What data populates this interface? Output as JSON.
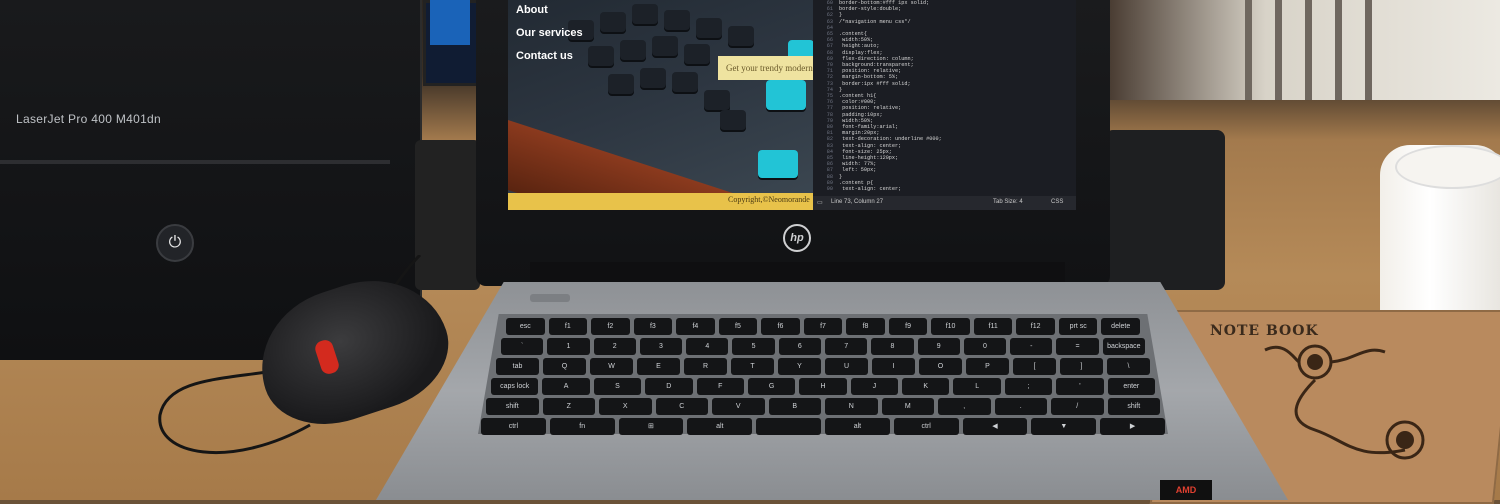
{
  "scene": {
    "printer": {
      "label": "LaserJet Pro 400 M401dn",
      "power_icon": "power-icon"
    },
    "laptop": {
      "brand_logo": "hp"
    },
    "notebook": {
      "title": "NOTE BOOK"
    },
    "sticker": {
      "text": "AMD"
    }
  },
  "website_preview": {
    "nav": [
      "About",
      "Our services",
      "Contact us"
    ],
    "promo_text": "Get your trendy modern w",
    "footer_text": "Copyright,©Neomorande"
  },
  "code_editor": {
    "lines": [
      {
        "n": "60",
        "text": "border-bottom:#fff 1px solid;"
      },
      {
        "n": "61",
        "text": "border-style:double;"
      },
      {
        "n": "62",
        "text": "}"
      },
      {
        "n": "63",
        "text": "/*navigation menu css*/"
      },
      {
        "n": "64",
        "text": ""
      },
      {
        "n": "65",
        "text": ".content{"
      },
      {
        "n": "66",
        "text": "    width:50%;"
      },
      {
        "n": "67",
        "text": "    height:auto;"
      },
      {
        "n": "68",
        "text": "    display:flex;"
      },
      {
        "n": "69",
        "text": "    flex-direction: column;"
      },
      {
        "n": "70",
        "text": "    background:transparent;"
      },
      {
        "n": "71",
        "text": "    position: relative;"
      },
      {
        "n": "72",
        "text": "    margin-bottom: 5%;"
      },
      {
        "n": "73",
        "text": "    border:1px #fff solid;"
      },
      {
        "n": "74",
        "text": "}"
      },
      {
        "n": "75",
        "text": ".content h1{"
      },
      {
        "n": "76",
        "text": "    color:#000;"
      },
      {
        "n": "77",
        "text": "    position: relative;"
      },
      {
        "n": "78",
        "text": "    padding:10px;"
      },
      {
        "n": "79",
        "text": "    width:50%;"
      },
      {
        "n": "80",
        "text": "    font-family:arial;"
      },
      {
        "n": "81",
        "text": "    margin:20px;"
      },
      {
        "n": "82",
        "text": "    text-decoration: underline #000;"
      },
      {
        "n": "83",
        "text": "    text-align: center;"
      },
      {
        "n": "84",
        "text": "    font-size: 25px;"
      },
      {
        "n": "85",
        "text": "    line-height:120px;"
      },
      {
        "n": "86",
        "text": "    width: 77%;"
      },
      {
        "n": "87",
        "text": "    left: 50px;"
      },
      {
        "n": "88",
        "text": "}"
      },
      {
        "n": "89",
        "text": ".content p{"
      },
      {
        "n": "90",
        "text": "    text-align: center;"
      }
    ],
    "status": {
      "position": "Line 73, Column 27",
      "tab": "Tab Size: 4",
      "lang": "CSS"
    }
  },
  "laptop_keyboard": {
    "rows": [
      [
        "esc",
        "f1",
        "f2",
        "f3",
        "f4",
        "f5",
        "f6",
        "f7",
        "f8",
        "f9",
        "f10",
        "f11",
        "f12",
        "prt sc",
        "delete"
      ],
      [
        "`",
        "1",
        "2",
        "3",
        "4",
        "5",
        "6",
        "7",
        "8",
        "9",
        "0",
        "-",
        "=",
        "backspace"
      ],
      [
        "tab",
        "Q",
        "W",
        "E",
        "R",
        "T",
        "Y",
        "U",
        "I",
        "O",
        "P",
        "[",
        "]",
        "\\"
      ],
      [
        "caps lock",
        "A",
        "S",
        "D",
        "F",
        "G",
        "H",
        "J",
        "K",
        "L",
        ";",
        "'",
        "enter"
      ],
      [
        "shift",
        "Z",
        "X",
        "C",
        "V",
        "B",
        "N",
        "M",
        ",",
        ".",
        "/",
        "shift"
      ],
      [
        "ctrl",
        "fn",
        "⊞",
        "alt",
        "",
        "alt",
        "ctrl",
        "◀",
        "▼",
        "▶"
      ]
    ]
  }
}
